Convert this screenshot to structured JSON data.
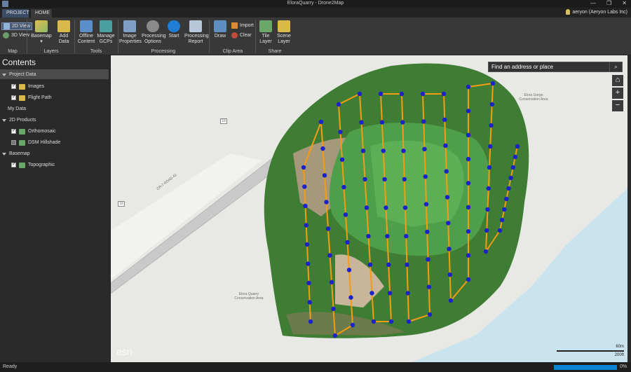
{
  "window": {
    "title": "EloraQuarry - Drone2Map",
    "minimize": "—",
    "maximize": "❐",
    "close": "✕"
  },
  "tabs": {
    "project": "PROJECT",
    "home": "HOME"
  },
  "user": {
    "name": "aeryon (Aeryon Labs Inc)"
  },
  "ribbon": {
    "view2d": "2D View",
    "view3d": "3D View",
    "basemap": "Basemap",
    "basemap_arrow": "▾",
    "add_data": "Add Data",
    "offline_content": "Offline Content",
    "manage_gcps": "Manage GCPs",
    "image_properties": "Image Properties",
    "processing_options": "Processing Options",
    "start": "Start",
    "processing_report": "Processing Report",
    "draw": "Draw",
    "import": "Import",
    "clear": "Clear",
    "tile_layer": "Tile Layer",
    "scene_layer": "Scene Layer",
    "groups": {
      "map": "Map",
      "layers": "Layers",
      "tools": "Tools",
      "processing": "Processing",
      "clip_area": "Clip Area",
      "share": "Share"
    }
  },
  "contents": {
    "title": "Contents",
    "groups": [
      {
        "label": "Project Data",
        "items": [
          {
            "label": "Images",
            "checked": true
          },
          {
            "label": "Flight Path",
            "checked": true
          }
        ]
      },
      {
        "label": "My Data",
        "items": []
      },
      {
        "label": "2D Products",
        "items": [
          {
            "label": "Orthomosaic",
            "checked": true
          },
          {
            "label": "DSM Hillshade",
            "checked": false
          }
        ]
      },
      {
        "label": "Basemap",
        "items": [
          {
            "label": "Topographic",
            "checked": true
          }
        ]
      }
    ]
  },
  "map": {
    "search_placeholder": "Find an address or place",
    "search_icon": "search-icon",
    "controls": {
      "home": "⌂",
      "zoom_in": "+",
      "zoom_out": "−"
    },
    "labels": {
      "road": "CR-7 ROAD 42",
      "road_shield_1": "18",
      "road_shield_2": "18",
      "area_east": "Elora Gorge Conservation Area",
      "area_southwest": "Elora Quarry Conservation Area"
    },
    "attribution": "esri",
    "scale_metric": "60m",
    "scale_imperial": "200ft",
    "colors": {
      "water": "#c9e4ef",
      "flight_path": "#f39c12",
      "waypoint": "#1a22c8",
      "quarry_water": "#4f9e4a"
    }
  },
  "status": {
    "text": "Ready",
    "progress_label": "0%",
    "progress_value": 0
  }
}
